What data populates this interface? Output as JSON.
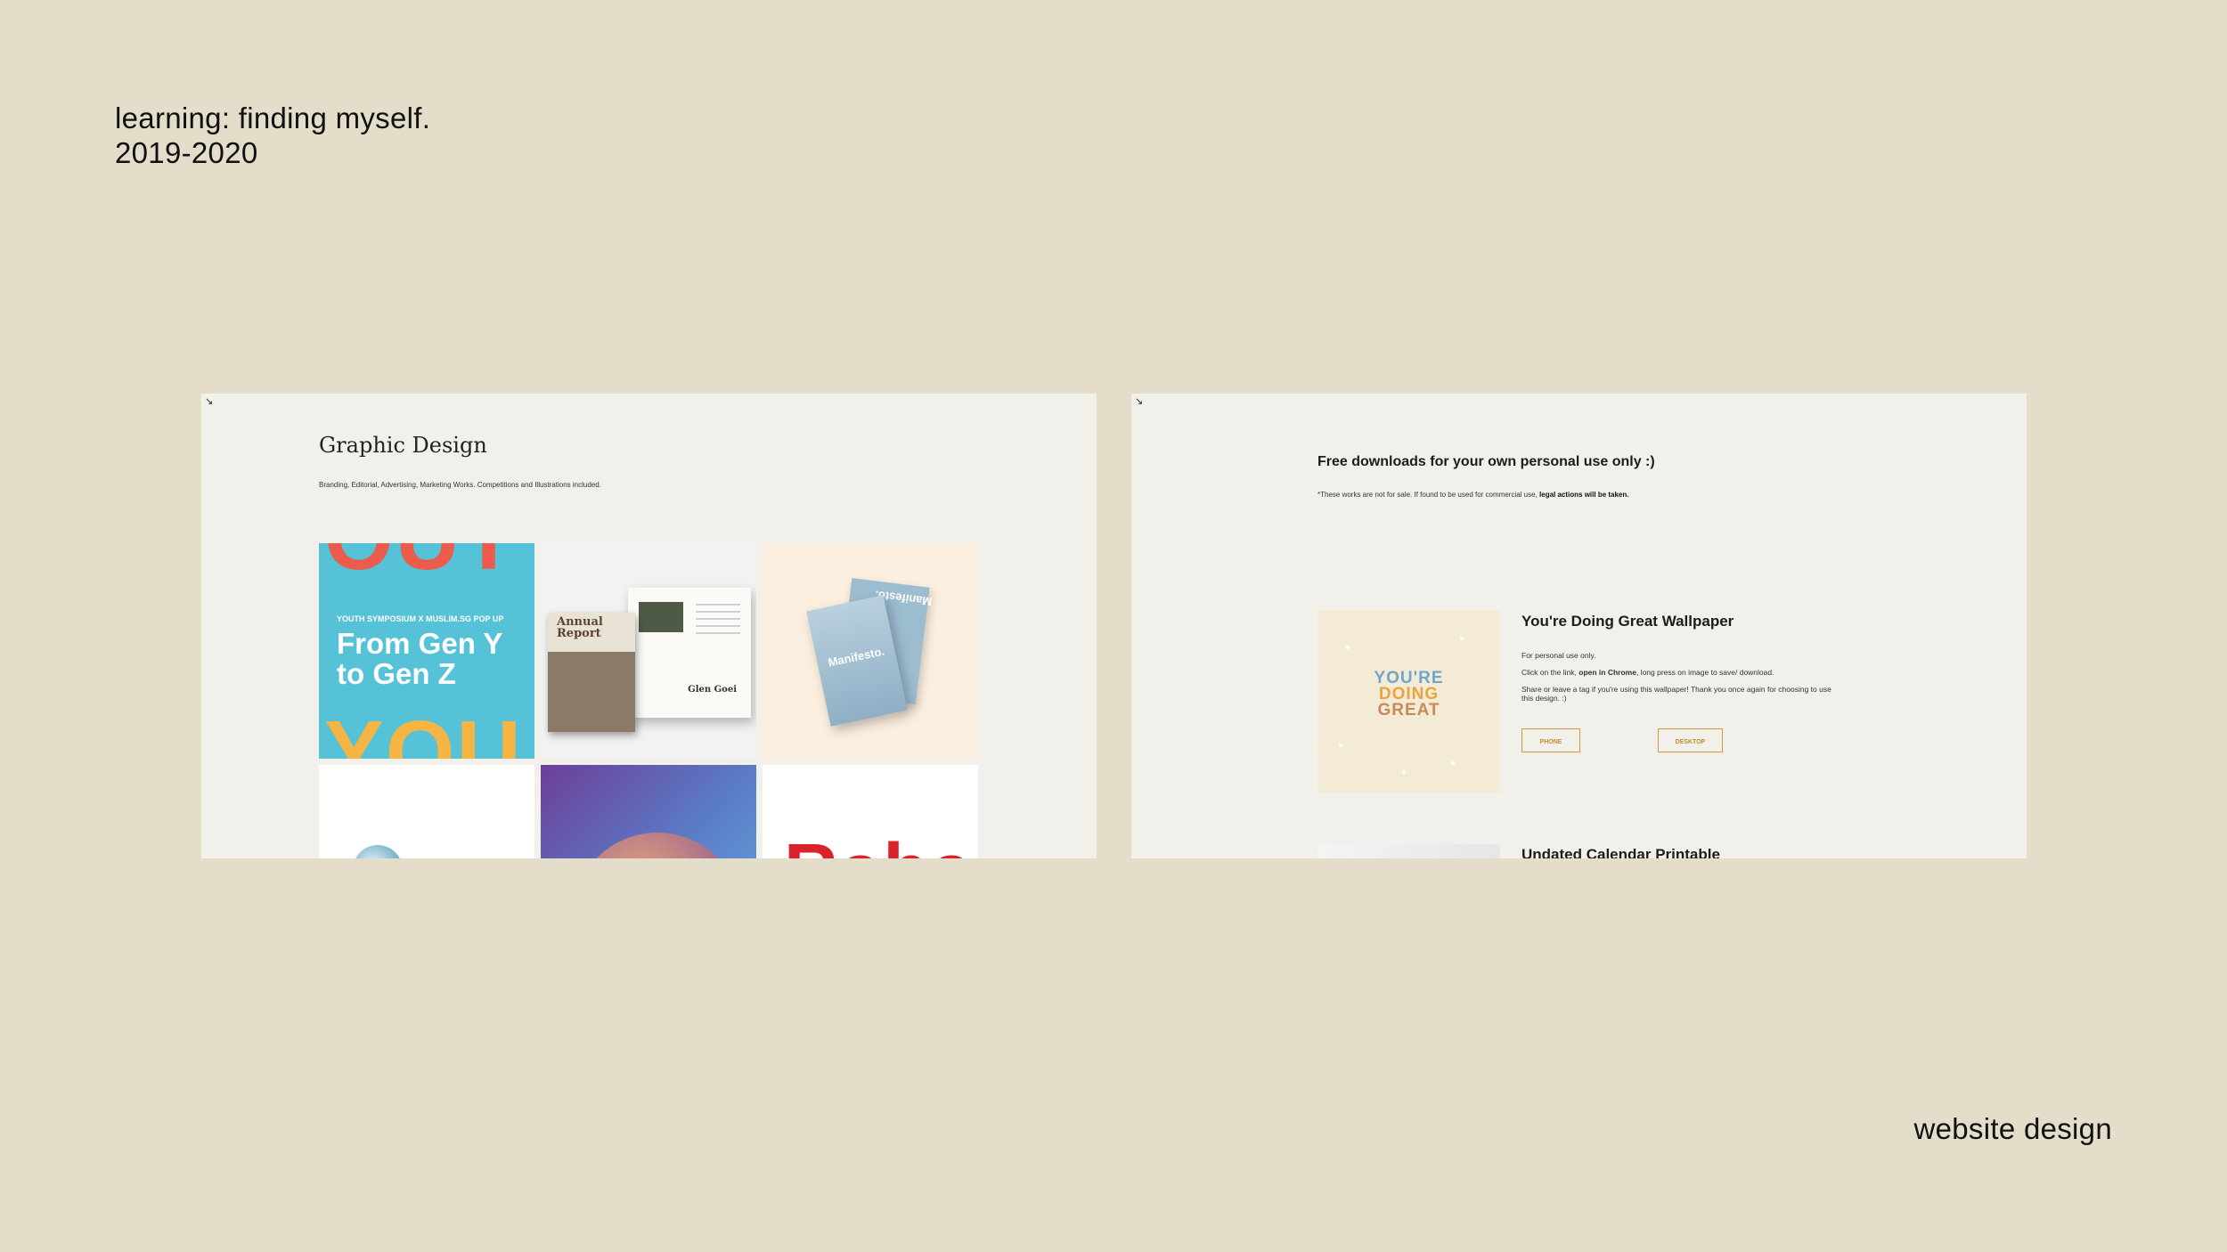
{
  "header": {
    "title": "learning: finding myself.",
    "years": "2019-2020"
  },
  "footer": {
    "label": "website design"
  },
  "left_screen": {
    "corner_icon": "expand-arrow-icon",
    "title": "Graphic Design",
    "subtitle": "Branding, Editorial, Advertising, Marketing Works. Competitions and Illustrations included.",
    "tiles": {
      "tile1": {
        "top_text": "OUT",
        "small_text": "YOUTH SYMPOSIUM X MUSLIM.SG POP UP",
        "headline_line1": "From Gen Y",
        "headline_line2": "to Gen Z",
        "bottom_text": "YOU"
      },
      "tile2": {
        "book_title_line1": "Annual",
        "book_title_line2": "Report",
        "signature": "Glen Goei"
      },
      "tile3": {
        "title": "Manifesto.",
        "back_title": "Manifesto."
      },
      "tile6": {
        "text": "Raba"
      }
    }
  },
  "right_screen": {
    "corner_icon": "expand-arrow-icon",
    "title": "Free downloads for your own personal use only :)",
    "note_prefix": "*These works are not for sale. If found to be used for commercial use, ",
    "note_bold": "legal actions will be taken.",
    "item1": {
      "title": "You're Doing Great Wallpaper",
      "desc1": "For personal use only.",
      "desc2_prefix": "Click on the link, ",
      "desc2_bold": "open in Chrome",
      "desc2_suffix": ", long press on image to save/ download.",
      "desc3": "Share or leave a tag if you're using this wallpaper! Thank you once again for choosing to use this design. :)",
      "wallpaper_line1": "YOU'RE",
      "wallpaper_line2": "DOING",
      "wallpaper_line3": "GREAT",
      "phone_label": "PHONE",
      "desktop_label": "DESKTOP"
    },
    "item2": {
      "title": "Undated Calendar Printable"
    }
  },
  "colors": {
    "background": "#e3ddca",
    "screen": "#f1f0ea",
    "accent_button": "#d19a3e"
  }
}
